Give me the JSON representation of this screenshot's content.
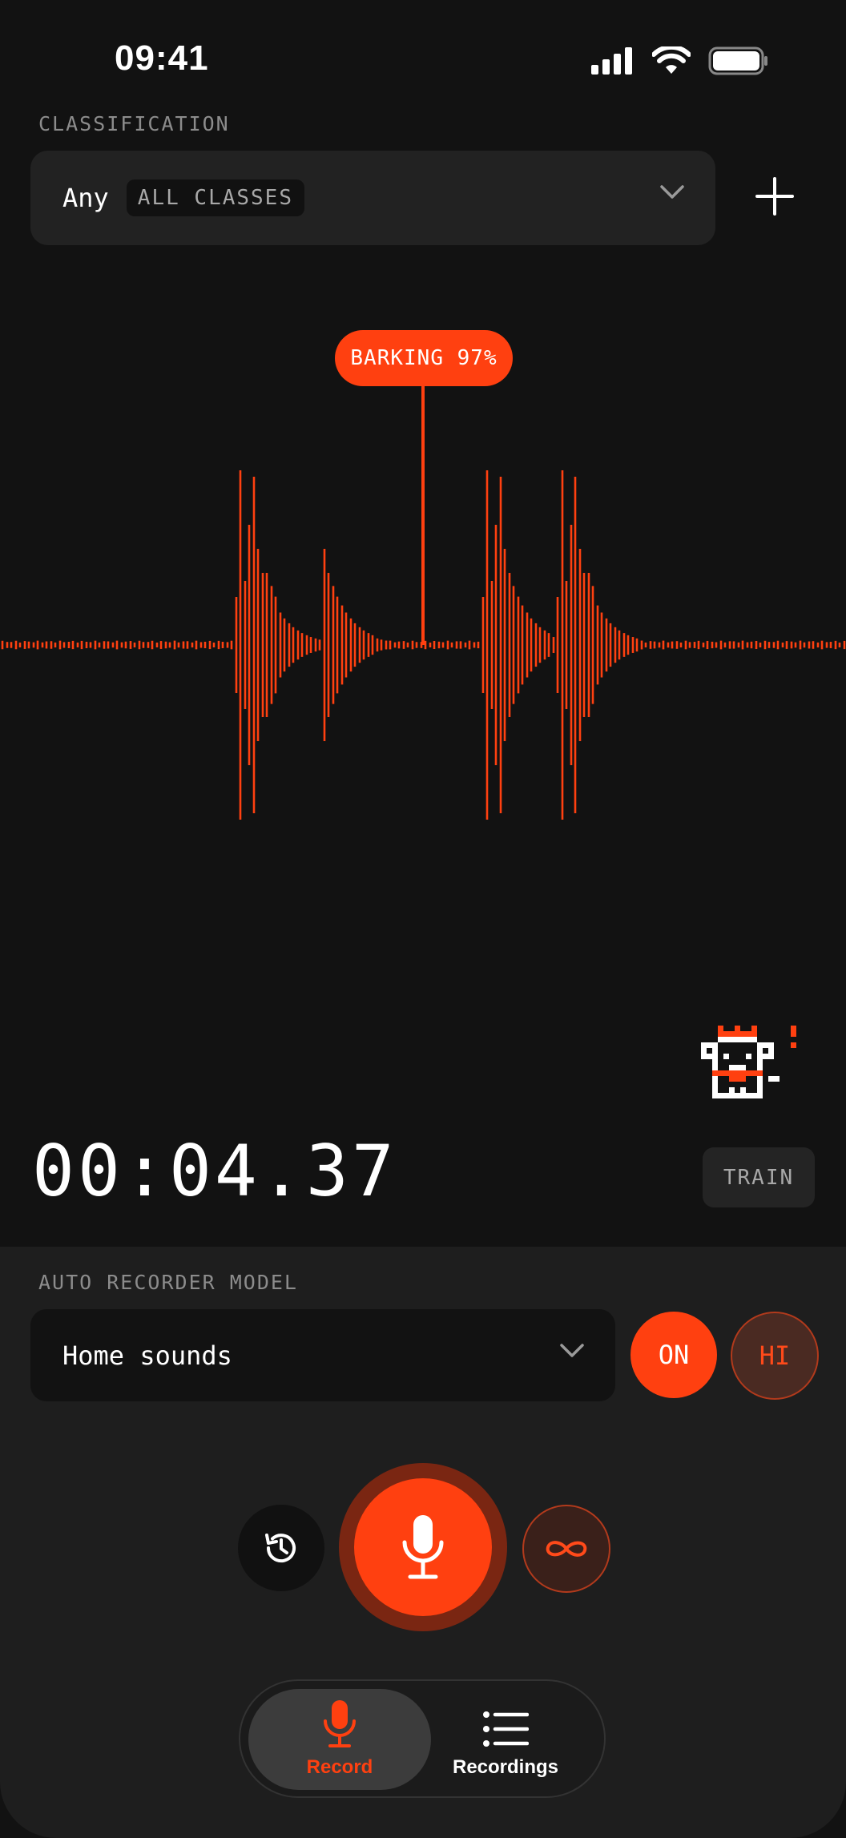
{
  "status_bar": {
    "time": "09:41"
  },
  "classification": {
    "section_label": "CLASSIFICATION",
    "selected": "Any",
    "tag": "ALL CLASSES"
  },
  "detection": {
    "label": "BARKING 97%"
  },
  "timer": "00:04.37",
  "train_button": "TRAIN",
  "auto_recorder": {
    "section_label": "AUTO RECORDER MODEL",
    "model": "Home sounds",
    "on_label": "ON",
    "hi_label": "HI"
  },
  "tabs": [
    {
      "label": "Record",
      "icon": "mic-icon",
      "active": true
    },
    {
      "label": "Recordings",
      "icon": "list-icon",
      "active": false
    }
  ],
  "colors": {
    "accent": "#ff4010",
    "background": "#121212",
    "panel": "#1e1e1e"
  }
}
